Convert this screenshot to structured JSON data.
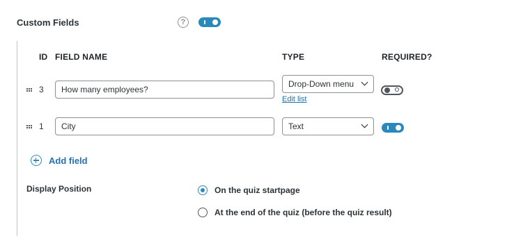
{
  "header": {
    "label": "Custom Fields",
    "help_glyph": "?",
    "enabled": true
  },
  "table": {
    "columns": {
      "id": "ID",
      "field_name": "FIELD NAME",
      "type": "TYPE",
      "required": "REQUIRED?"
    },
    "rows": [
      {
        "id": "3",
        "field_name": "How many employees?",
        "type": "Drop-Down menu",
        "edit_link": "Edit list",
        "required": false
      },
      {
        "id": "1",
        "field_name": "City",
        "type": "Text",
        "required": true
      }
    ]
  },
  "add_field_label": "Add field",
  "display_position": {
    "label": "Display Position",
    "options": [
      {
        "label": "On the quiz startpage",
        "selected": true
      },
      {
        "label": "At the end of the quiz (before the quiz result)",
        "selected": false
      }
    ]
  },
  "colors": {
    "accent": "#2a88ba",
    "link": "#2271b1",
    "text": "#2c3338",
    "border": "#8c8f94"
  },
  "icons": [
    "help-icon",
    "drag-handle-icon",
    "chevron-down-icon",
    "add-circle-icon"
  ]
}
